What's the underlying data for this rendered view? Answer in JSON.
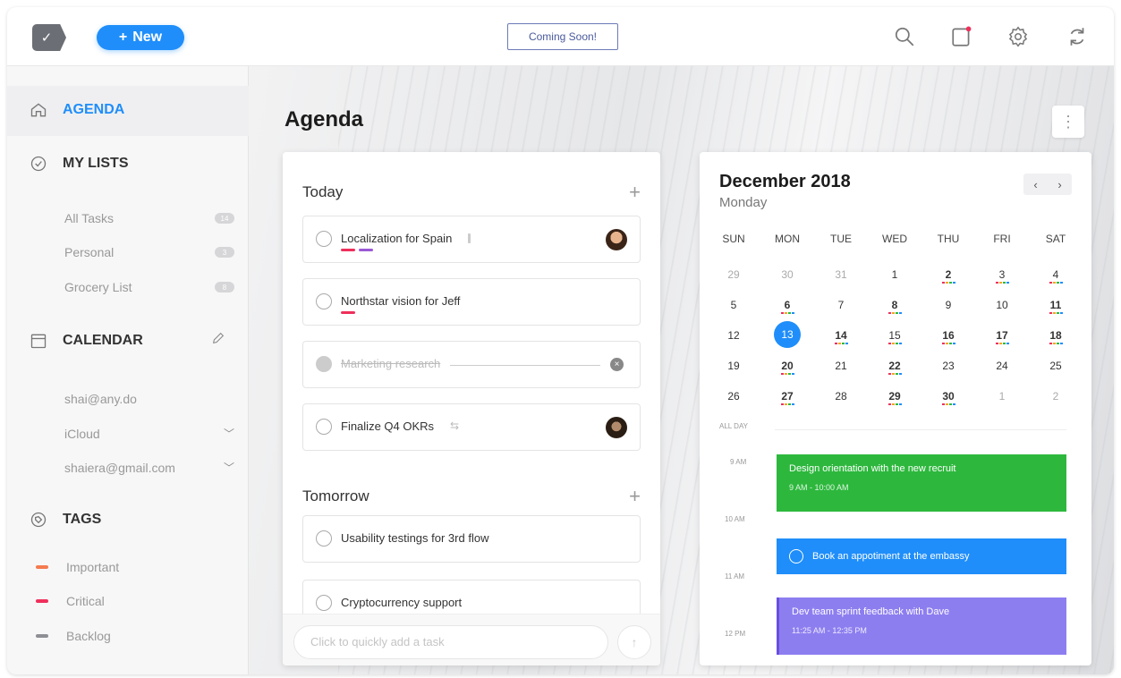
{
  "topbar": {
    "new_label": "New",
    "coming_soon": "Coming Soon!",
    "icons": [
      "search-icon",
      "notification-icon",
      "gear-icon",
      "sync-icon"
    ]
  },
  "sidebar": {
    "agenda": "AGENDA",
    "my_lists": "MY LISTS",
    "lists": [
      {
        "label": "All Tasks",
        "count": "14"
      },
      {
        "label": "Personal",
        "count": "3"
      },
      {
        "label": "Grocery List",
        "count": "8"
      }
    ],
    "calendar": "CALENDAR",
    "accounts": [
      {
        "label": "shai@any.do"
      },
      {
        "label": "iCloud"
      },
      {
        "label": "shaiera@gmail.com"
      }
    ],
    "tags_title": "TAGS",
    "tags": [
      {
        "label": "Important",
        "color": "#f47b50"
      },
      {
        "label": "Critical",
        "color": "#ef2f5b"
      },
      {
        "label": "Backlog",
        "color": "#8d8f94"
      }
    ]
  },
  "main": {
    "title": "Agenda",
    "today": "Today",
    "tomorrow": "Tomorrow",
    "tasks_today": [
      {
        "text": "Localization for Spain"
      },
      {
        "text": "Northstar vision for Jeff"
      },
      {
        "text": "Marketing research"
      },
      {
        "text": "Finalize Q4 OKRs"
      }
    ],
    "tasks_tomorrow": [
      {
        "text": "Usability testings for 3rd flow"
      },
      {
        "text": "Cryptocurrency support"
      }
    ],
    "quick_add_placeholder": "Click to quickly add a task"
  },
  "calendar": {
    "month": "December 2018",
    "weekday": "Monday",
    "days_of_week": [
      "SUN",
      "MON",
      "TUE",
      "WED",
      "THU",
      "FRI",
      "SAT"
    ],
    "weeks": [
      [
        "29",
        "30",
        "31",
        "1",
        "2",
        "3",
        "4"
      ],
      [
        "5",
        "6",
        "7",
        "8",
        "9",
        "10",
        "11"
      ],
      [
        "12",
        "13",
        "14",
        "15",
        "16",
        "17",
        "18"
      ],
      [
        "19",
        "20",
        "21",
        "22",
        "23",
        "24",
        "25"
      ],
      [
        "26",
        "27",
        "28",
        "29",
        "30",
        "1",
        "2"
      ]
    ],
    "selected_day": "13",
    "all_day": "ALL DAY",
    "times": [
      "9 AM",
      "10 AM",
      "11 AM",
      "12 PM"
    ],
    "events": [
      {
        "title": "Design orientation with the new recruit",
        "time": "9 AM - 10:00 AM",
        "color": "#2db83d"
      },
      {
        "title": "Book an appotiment at the embassy",
        "time": "",
        "color": "#1f8efa"
      },
      {
        "title": "Dev team sprint feedback with Dave",
        "time": "11:25 AM - 12:35 PM",
        "color": "#8d7ef0"
      }
    ]
  }
}
